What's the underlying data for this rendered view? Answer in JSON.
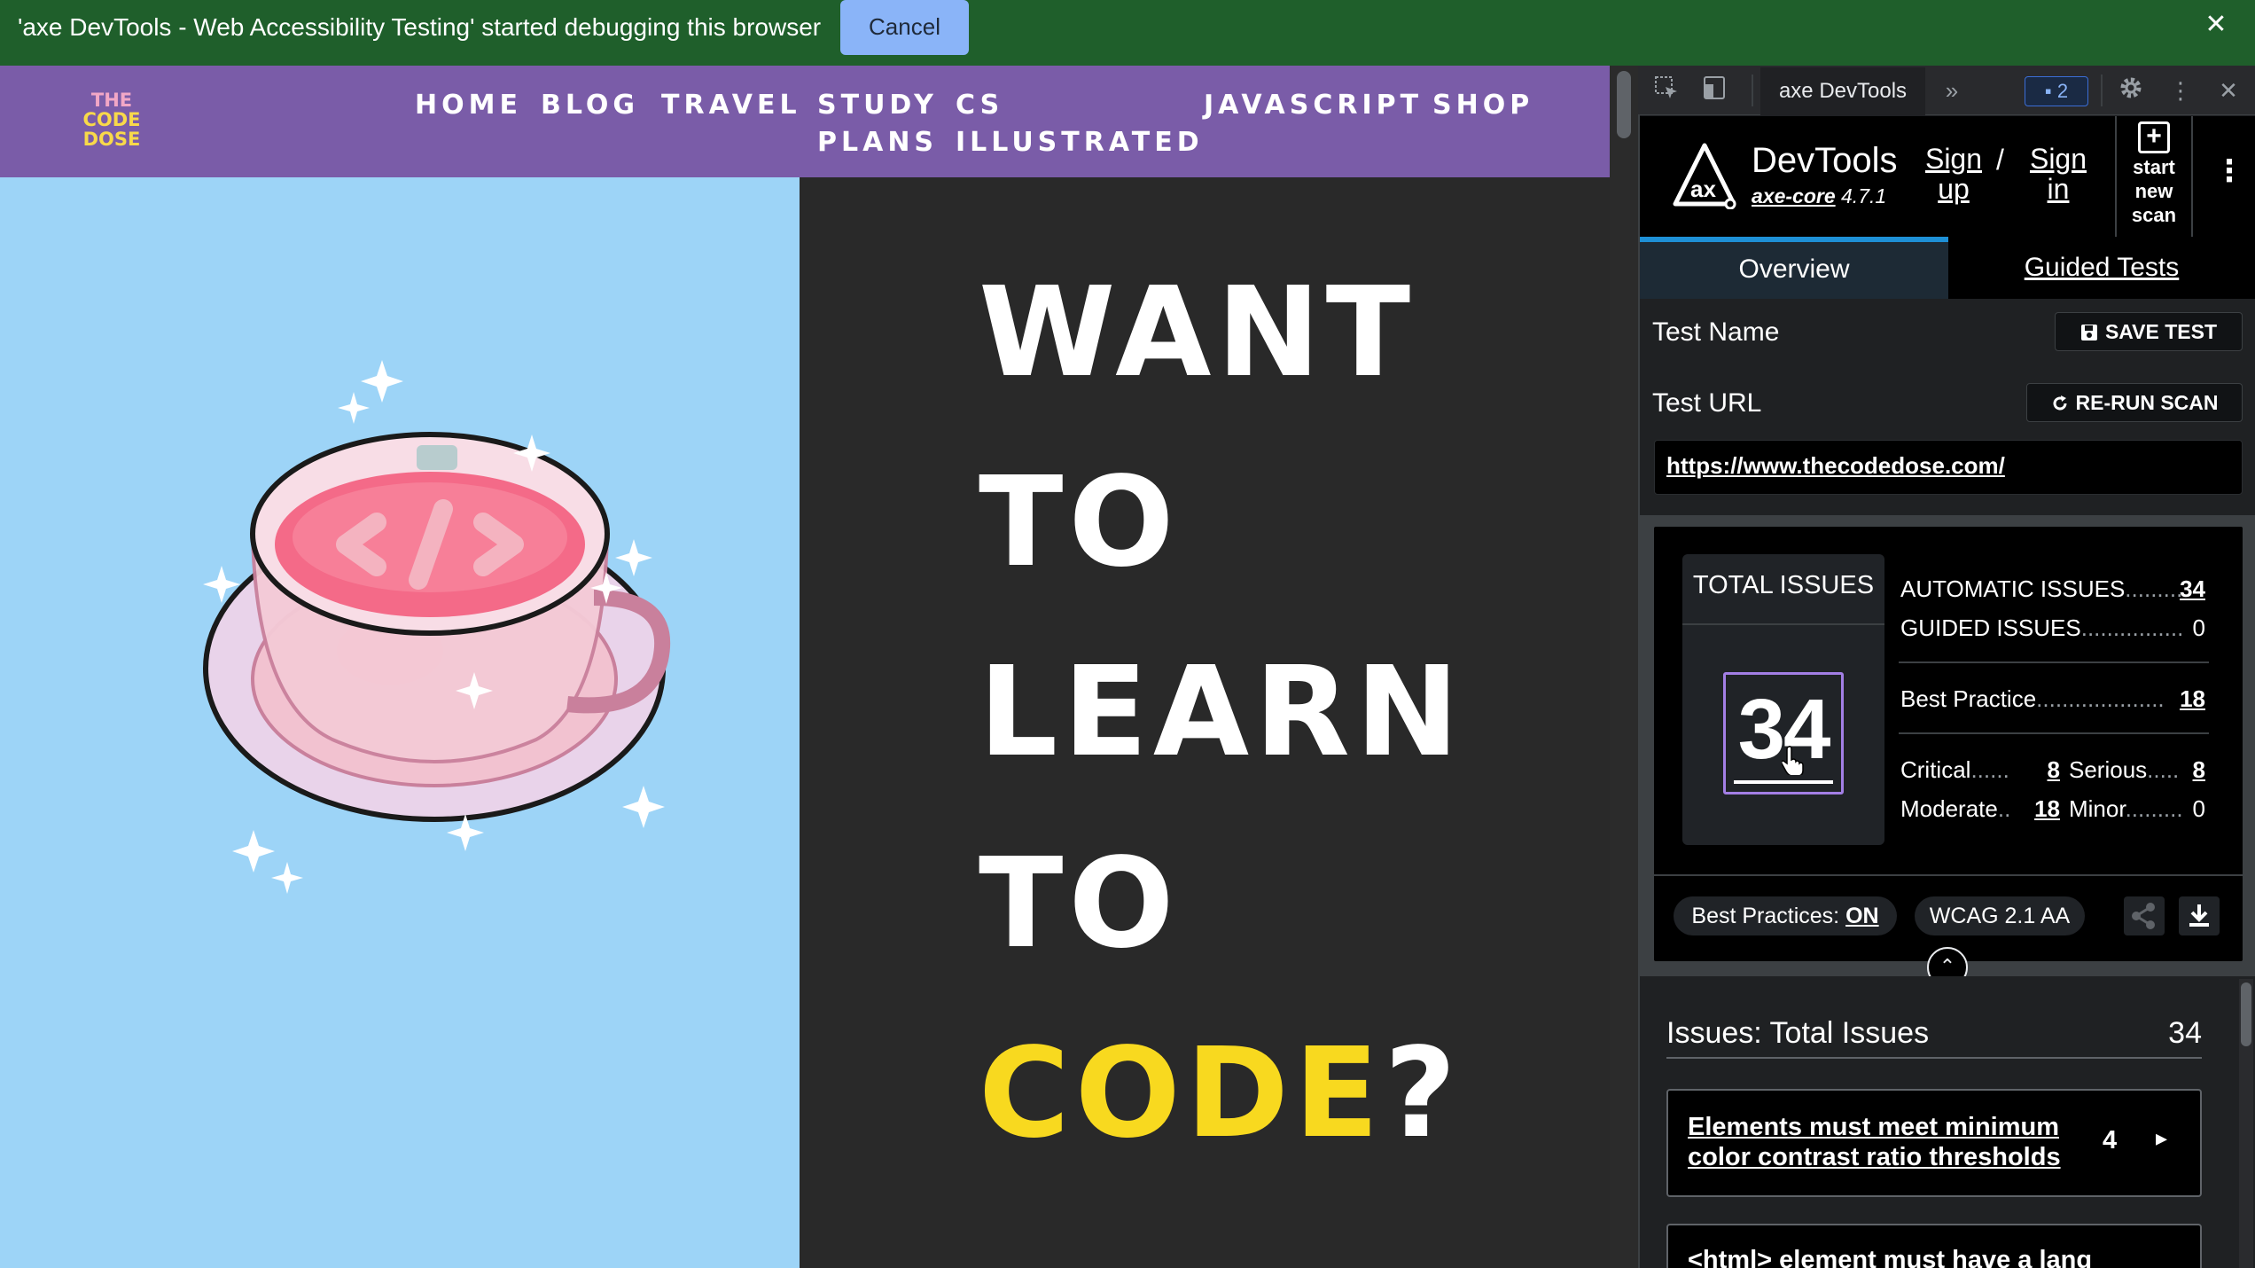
{
  "debug_bar": {
    "message": "'axe DevTools - Web Accessibility Testing' started debugging this browser",
    "cancel_label": "Cancel",
    "close_glyph": "✕",
    "color": "#1f5f2b"
  },
  "site": {
    "logo": {
      "line1": "THE",
      "line2": "CODE",
      "line3": "DOSE"
    },
    "nav": {
      "home": "HOME",
      "blog": "BLOG",
      "travel": "TRAVEL",
      "study_line1": "STUDY",
      "study_line2": "PLANS",
      "cs_line1": "CS",
      "cs_line2": "ILLUSTRATED",
      "javascript": "JAVASCRIPT",
      "shop": "SHOP"
    },
    "hero": {
      "word1": "WANT",
      "word2": "TO",
      "word3": "LEARN",
      "word4": "TO",
      "word5_highlight": "CODE",
      "word5_rest": "?"
    },
    "colors": {
      "nav": "#7a5ca8",
      "hero_left": "#9dd4f7",
      "hero_right": "#292929",
      "highlight": "#f8d91f"
    }
  },
  "devtools_toolbar": {
    "active_tab": "axe DevTools",
    "more_glyph": "»",
    "messages_count": "2",
    "icons": [
      "inspect-icon",
      "device-toggle-icon",
      "more-tabs-icon",
      "messages-icon",
      "settings-icon",
      "kebab-icon",
      "close-icon"
    ]
  },
  "axe": {
    "title": "DevTools",
    "core_label": "axe-core",
    "core_version": "4.7.1",
    "signup_line1": "Sign",
    "signup_line2": "up",
    "slash": "/",
    "signin_line1": "Sign",
    "signin_line2": "in",
    "new_scan_line1": "start",
    "new_scan_line2": "new",
    "new_scan_line3": "scan",
    "tabs": {
      "overview": "Overview",
      "guided": "Guided Tests"
    },
    "test_name_label": "Test Name",
    "save_test_label": "SAVE TEST",
    "test_url_label": "Test URL",
    "rerun_label": "RE-RUN SCAN",
    "test_url": "https://www.thecodedose.com/",
    "summary": {
      "total_title": "TOTAL ISSUES",
      "total": "34",
      "automatic_label": "AUTOMATIC ISSUES",
      "automatic": "34",
      "guided_label": "GUIDED ISSUES",
      "guided": "0",
      "best_practice_label": "Best Practice",
      "best_practice": "18",
      "critical_label": "Critical",
      "critical": "8",
      "serious_label": "Serious",
      "serious": "8",
      "moderate_label": "Moderate",
      "moderate": "18",
      "minor_label": "Minor",
      "minor": "0"
    },
    "best_practices_label": "Best Practices:",
    "best_practices_state": "ON",
    "standard": "WCAG 2.1 AA",
    "issues_title": "Issues: Total Issues",
    "issues_count": "34",
    "issues": [
      {
        "title": "Elements must meet minimum color contrast ratio thresholds",
        "count": "4"
      },
      {
        "title": "<html> element must have a lang"
      }
    ],
    "colors": {
      "accent_tab": "#1e90d6",
      "total_box": "#a37fe5"
    }
  }
}
